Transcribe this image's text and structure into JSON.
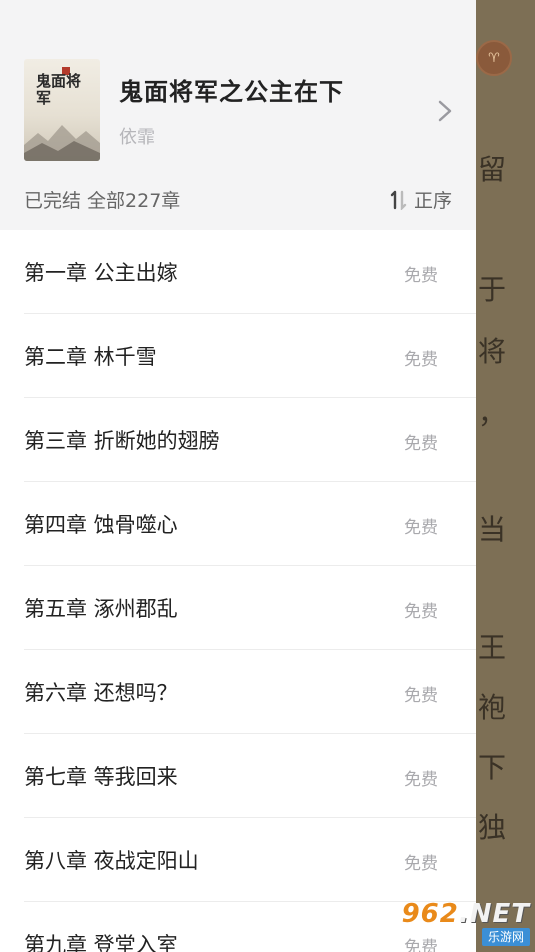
{
  "reader": {
    "badge_icon": "ram-badge",
    "chars": [
      "留",
      "于",
      "将",
      "，",
      "当",
      "王",
      "袍",
      "下",
      "独"
    ]
  },
  "book": {
    "cover_title": "鬼面将军",
    "title": "鬼面将军之公主在下",
    "author": "依霏",
    "status": "已完结 全部227章",
    "sort_label": "正序",
    "sort_icon": "sort-order-icon",
    "chevron_icon": "chevron-right-icon"
  },
  "chapters": [
    {
      "title": "第一章 公主出嫁",
      "tag": "免费"
    },
    {
      "title": "第二章 林千雪",
      "tag": "免费"
    },
    {
      "title": "第三章 折断她的翅膀",
      "tag": "免费"
    },
    {
      "title": "第四章 蚀骨噬心",
      "tag": "免费"
    },
    {
      "title": "第五章 涿州郡乱",
      "tag": "免费"
    },
    {
      "title": "第六章  还想吗？",
      "tag": "免费"
    },
    {
      "title": "第七章 等我回来",
      "tag": "免费"
    },
    {
      "title": "第八章 夜战定阳山",
      "tag": "免费"
    },
    {
      "title": "第九章 登堂入室",
      "tag": "免费"
    }
  ],
  "watermark": {
    "main": "962",
    "net": ".NET",
    "sub": "乐游网"
  }
}
